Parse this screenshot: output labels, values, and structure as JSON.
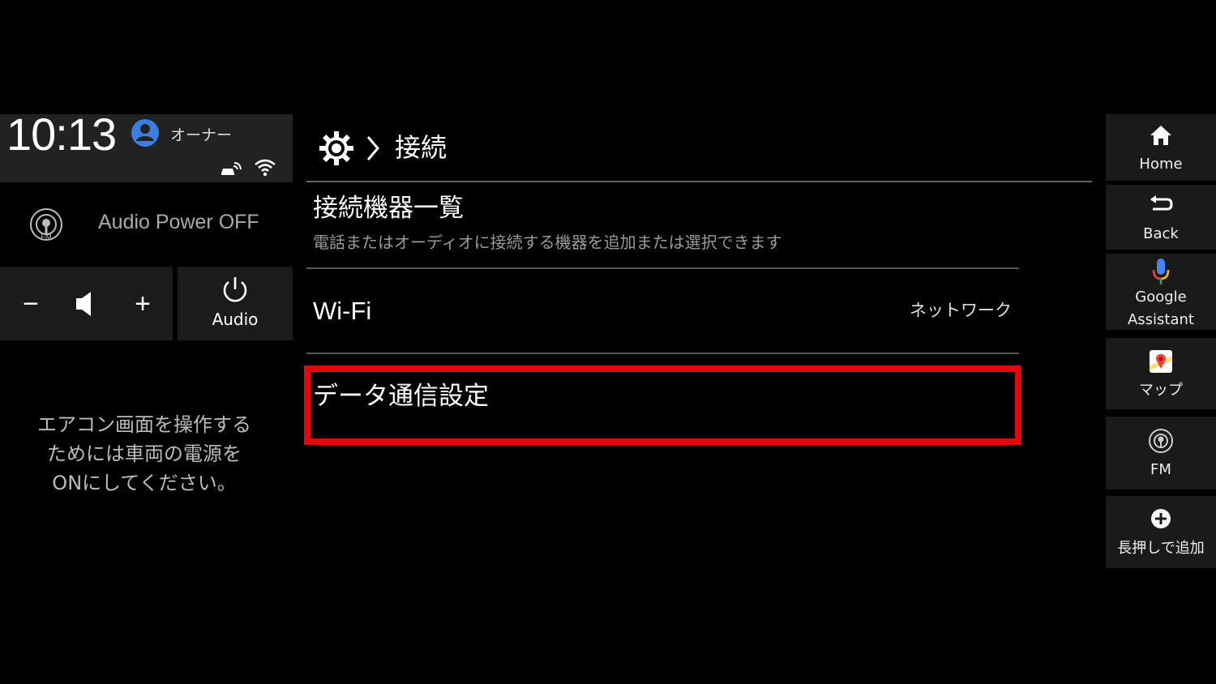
{
  "status": {
    "time": "10:13",
    "user_name": "オーナー"
  },
  "left_panel": {
    "audio_power": "Audio Power OFF",
    "vol_minus": "−",
    "vol_plus": "+",
    "audio_button_label": "Audio",
    "ac_notice": [
      "エアコン画面を操作する",
      "ためには車両の電源を",
      "ONにしてください。"
    ]
  },
  "header": {
    "title": "接続"
  },
  "settings_list": [
    {
      "title": "接続機器一覧",
      "subtitle": "電話またはオーディオに接続する機器を追加または選択できます"
    },
    {
      "title": "Wi-Fi",
      "value": "ネットワーク"
    },
    {
      "title": "データ通信設定"
    }
  ],
  "right_rail": {
    "home": "Home",
    "back": "Back",
    "assistant": [
      "Google",
      "Assistant"
    ],
    "map": "マップ",
    "fm": "FM",
    "add": "長押しで追加"
  },
  "colors": {
    "background": "#000000",
    "panel": "#1b1b1b",
    "highlight_border": "#e5050b",
    "user_icon": "#3d7fe0"
  }
}
